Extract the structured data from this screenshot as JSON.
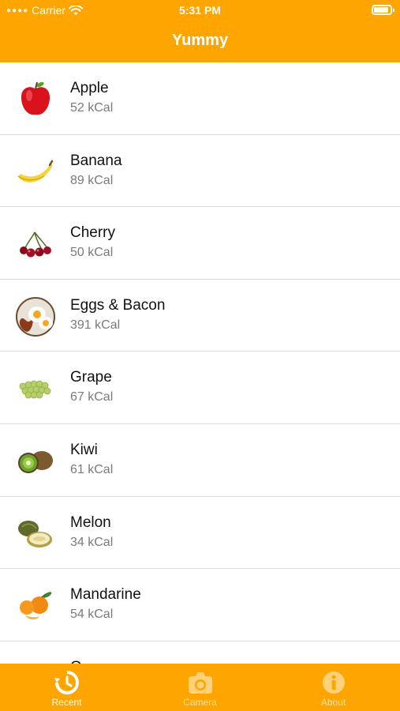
{
  "status_bar": {
    "carrier": "Carrier",
    "time": "5:31 PM",
    "battery_level": 0.9
  },
  "nav": {
    "title": "Yummy"
  },
  "items": [
    {
      "name": "Apple",
      "calories": "52 kCal",
      "icon": "apple-icon"
    },
    {
      "name": "Banana",
      "calories": "89 kCal",
      "icon": "banana-icon"
    },
    {
      "name": "Cherry",
      "calories": "50 kCal",
      "icon": "cherry-icon"
    },
    {
      "name": "Eggs & Bacon",
      "calories": "391 kCal",
      "icon": "eggs-bacon-icon"
    },
    {
      "name": "Grape",
      "calories": "67 kCal",
      "icon": "grape-icon"
    },
    {
      "name": "Kiwi",
      "calories": "61 kCal",
      "icon": "kiwi-icon"
    },
    {
      "name": "Melon",
      "calories": "34 kCal",
      "icon": "melon-icon"
    },
    {
      "name": "Mandarine",
      "calories": "54 kCal",
      "icon": "mandarine-icon"
    },
    {
      "name": "O",
      "calories": "",
      "icon": "orange-icon"
    }
  ],
  "tabbar": {
    "tabs": [
      {
        "label": "Recent",
        "icon": "recent-icon",
        "active": true
      },
      {
        "label": "Camera",
        "icon": "camera-icon",
        "active": false
      },
      {
        "label": "About",
        "icon": "info-icon",
        "active": false
      }
    ]
  },
  "colors": {
    "accent": "#FFA500",
    "inactive_tab": "#FFE2A8"
  }
}
